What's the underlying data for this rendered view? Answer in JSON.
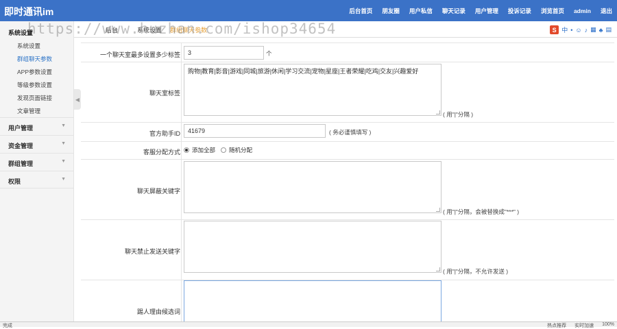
{
  "app": {
    "brand": "即时通讯im"
  },
  "topnav": [
    "后台首页",
    "朋友圈",
    "用户私信",
    "聊天记录",
    "用户管理",
    "投诉记录",
    "浏览首页",
    "admin",
    "退出"
  ],
  "watermark": "https://www.huzhan.com/ishop34654",
  "tabs": {
    "home": "后台",
    "settings": "系统设置",
    "group_params": "群组聊天参数"
  },
  "ime": {
    "lang": "中"
  },
  "sidebar": {
    "title": "系统设置",
    "subitems": [
      "系统设置",
      "群组聊天参数",
      "APP参数设置",
      "等级参数设置",
      "发现页面链接",
      "文章管理"
    ],
    "groups": [
      "用户管理",
      "资金管理",
      "群组管理",
      "权限"
    ]
  },
  "form": {
    "max_tags": {
      "label": "一个聊天室最多设置多少标签",
      "value": "3",
      "unit": "个"
    },
    "room_tags": {
      "label": "聊天室标签",
      "value": "购物|教育|影音|游戏|同城|旅游|休闲|学习交流|宠物|星座|王者荣耀|吃鸡|交友|兴趣爱好",
      "hint": "( 用\"|\"分隔 )"
    },
    "assistant_id": {
      "label": "官方助手ID",
      "value": "41679",
      "hint": "( 务必谨慎填写 )"
    },
    "cs_mode": {
      "label": "客服分配方式",
      "options": [
        "添加全部",
        "随机分配"
      ],
      "selected": "添加全部"
    },
    "block_words": {
      "label": "聊天屏蔽关键字",
      "value": "",
      "hint": "( 用\"|\"分隔，会被替换成\"***\" )"
    },
    "forbid_words": {
      "label": "聊天禁止发送关键字",
      "value": "",
      "hint": "( 用\"|\"分隔，不允许发送 )"
    },
    "kick_reasons": {
      "label": "踢人理由候选词",
      "value": ""
    }
  },
  "statusbar": {
    "left": "完成",
    "hot": "热点推荐",
    "speed": "实时加速",
    "zoom": "100%"
  }
}
